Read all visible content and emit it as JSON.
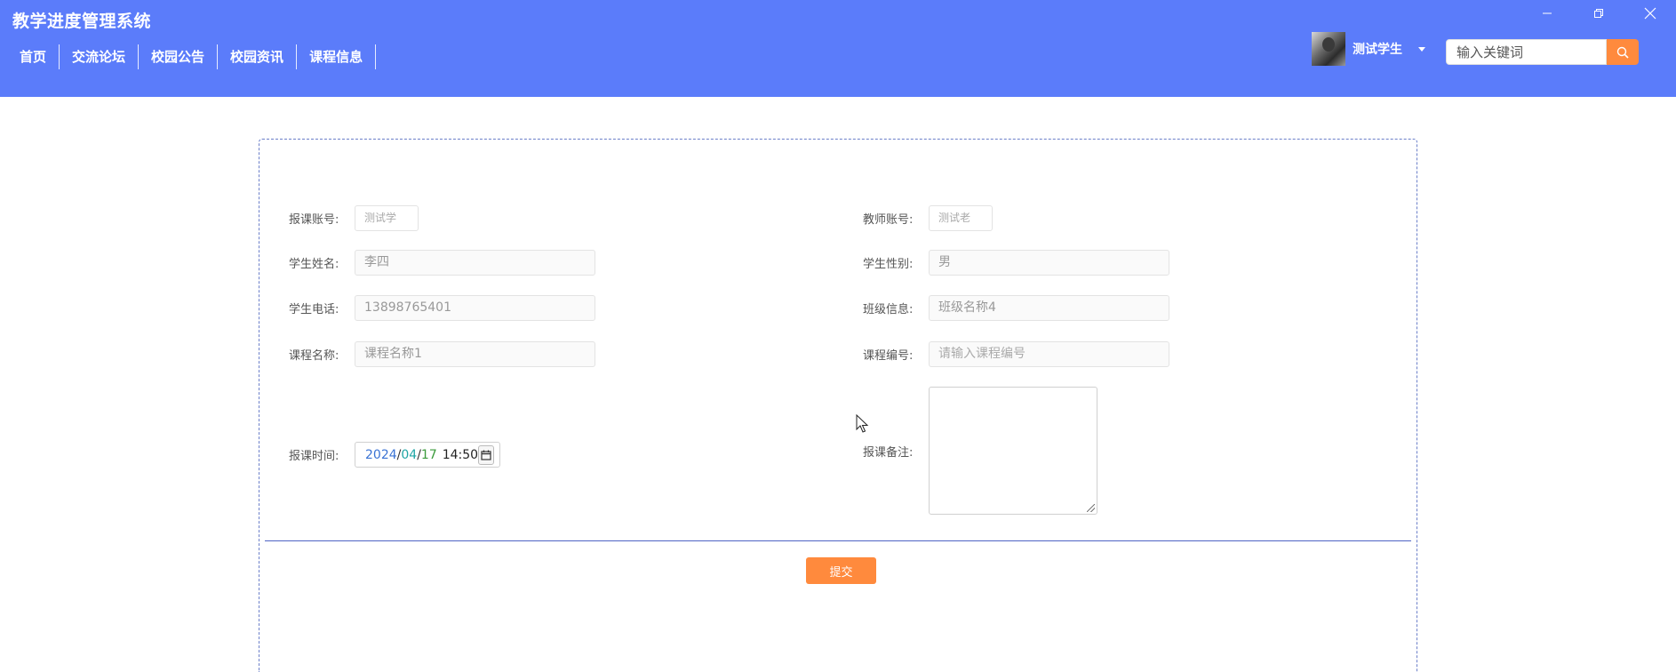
{
  "header": {
    "app_title": "教学进度管理系统",
    "nav": [
      {
        "label": "首页"
      },
      {
        "label": "交流论坛"
      },
      {
        "label": "校园公告"
      },
      {
        "label": "校园资讯"
      },
      {
        "label": "课程信息"
      }
    ],
    "user": {
      "name": "测试学生"
    },
    "search": {
      "placeholder": "输入关键词"
    },
    "window_controls": [
      "minimize-icon",
      "restore-icon",
      "close-icon"
    ]
  },
  "form": {
    "fields": {
      "enroll_account": {
        "label": "报课账号:",
        "value": "测试学"
      },
      "teacher_account": {
        "label": "教师账号:",
        "value": "测试老"
      },
      "student_name": {
        "label": "学生姓名:",
        "value": "李四"
      },
      "student_gender": {
        "label": "学生性别:",
        "value": "男"
      },
      "student_phone": {
        "label": "学生电话:",
        "value": "13898765401"
      },
      "class_info": {
        "label": "班级信息:",
        "value": "班级名称4"
      },
      "course_name": {
        "label": "课程名称:",
        "value": "课程名称1"
      },
      "course_code": {
        "label": "课程编号:",
        "placeholder": "请输入课程编号"
      },
      "enroll_time": {
        "label": "报课时间:",
        "year": "2024",
        "month": "04",
        "day": "17",
        "time": "14:50"
      },
      "enroll_note": {
        "label": "报课备注:",
        "value": ""
      }
    },
    "submit_label": "提交"
  },
  "colors": {
    "header_bg": "#5b7cfa",
    "accent": "#ff8a3d",
    "border": "#6b7fc9"
  }
}
